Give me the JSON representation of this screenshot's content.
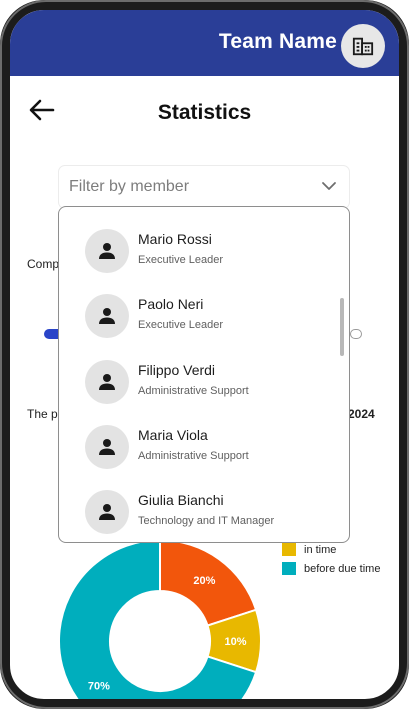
{
  "header": {
    "team_name": "Team Name"
  },
  "page": {
    "title": "Statistics"
  },
  "filter": {
    "placeholder": "Filter by member"
  },
  "background_fragments": {
    "completed_prefix": "Comp",
    "period_prefix": "The p",
    "period_year_suffix": "2024"
  },
  "members": [
    {
      "name": "Mario Rossi",
      "role": "Executive Leader"
    },
    {
      "name": "Paolo Neri",
      "role": "Executive Leader"
    },
    {
      "name": "Filippo Verdi",
      "role": "Administrative Support"
    },
    {
      "name": "Maria Viola",
      "role": "Administrative Support"
    },
    {
      "name": "Giulia Bianchi",
      "role": "Technology and IT Manager"
    }
  ],
  "legend": [
    {
      "label": "in time",
      "color": "#e8b800"
    },
    {
      "label": "before due time",
      "color": "#00aebd"
    }
  ],
  "chart_data": {
    "type": "pie",
    "donut": true,
    "categories": [
      "",
      "in time",
      "before due time"
    ],
    "values": [
      20,
      10,
      70
    ],
    "value_labels": [
      "20%",
      "10%",
      "70%"
    ],
    "colors": [
      "#f2560c",
      "#e8b800",
      "#00aebd"
    ]
  },
  "colors": {
    "header": "#2a3e97",
    "progress": "#2a44c8"
  }
}
